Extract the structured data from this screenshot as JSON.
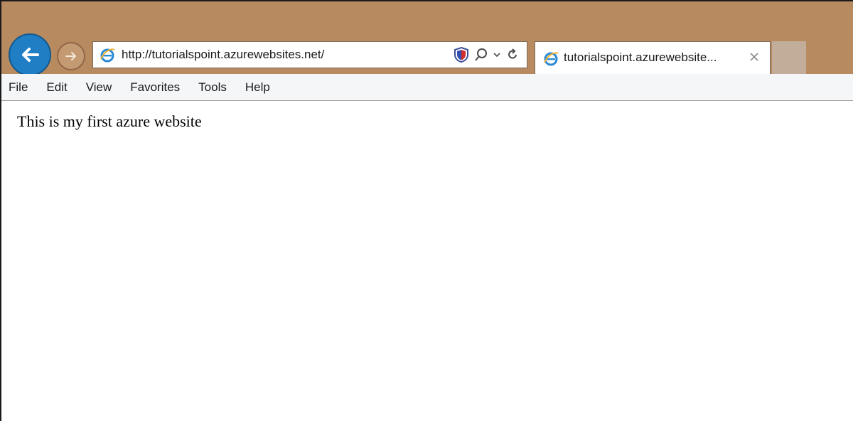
{
  "browser": {
    "address_bar": {
      "url": "http://tutorialspoint.azurewebsites.net/"
    },
    "tab": {
      "title": "tutorialspoint.azurewebsite..."
    },
    "menu": [
      "File",
      "Edit",
      "View",
      "Favorites",
      "Tools",
      "Help"
    ],
    "icons": {
      "back": "back-arrow-icon",
      "forward": "forward-arrow-icon",
      "site": "internet-explorer-icon",
      "shield": "shield-icon",
      "search": "search-icon",
      "dropdown": "chevron-down-icon",
      "refresh": "refresh-icon",
      "close": "close-icon"
    },
    "colors": {
      "titlebar": "#b88a60",
      "back_button": "#1f7ec4"
    }
  },
  "page": {
    "text": "This is my first azure website"
  }
}
